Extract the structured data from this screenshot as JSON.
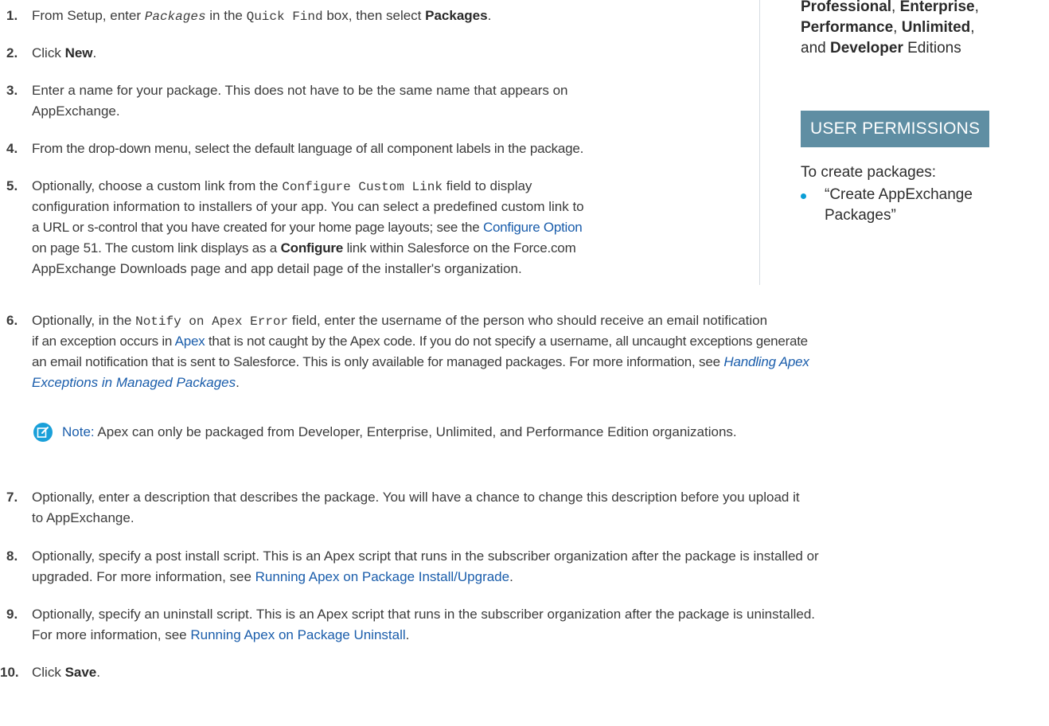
{
  "steps": {
    "s1": {
      "num": "1.",
      "pre": "From Setup, enter ",
      "code": "Packages",
      "mid": " in the ",
      "code2": "Quick Find",
      "post": " box, then select ",
      "bold": "Packages",
      "end": "."
    },
    "s2": {
      "num": "2.",
      "pre": "Click ",
      "bold": "New",
      "end": "."
    },
    "s3": {
      "num": "3.",
      "line1": "Enter a name for your package. This does not have to be the same name that appears on",
      "line2": "AppExchange."
    },
    "s4": {
      "num": "4.",
      "text": "From the drop-down menu, select the default language of all component labels in the package."
    },
    "s5": {
      "num": "5.",
      "l1_pre": "Optionally, choose a custom link from the ",
      "l1_code": "Configure Custom Link",
      "l1_post": " field to display",
      "l2": "configuration information to installers of your app. You can select a predefined custom link to",
      "l3_pre": "a URL or s-control that you have created for your home page layouts; see the ",
      "l3_link": "Configure Option",
      "l4_pre": "on page 51. The custom link displays as a ",
      "l4_bold": "Configure",
      "l4_post": " link within Salesforce on the Force.com",
      "l5": "AppExchange Downloads page and app detail page of the installer's organization."
    },
    "s6": {
      "num": "6.",
      "l1_pre": "Optionally, in the ",
      "l1_code": "Notify on Apex Error",
      "l1_post": " field, enter the username of the person who should receive an email notification",
      "l2_pre": "if an exception occurs in ",
      "l2_link": "Apex",
      "l2_post": " that is not caught by the Apex code. If you do not specify a username, all uncaught exceptions generate",
      "l3_pre": "an email notification that is sent to Salesforce. This is only available for managed packages. For more information, see ",
      "l3_link": "Handling Apex",
      "l4_link": "Exceptions in Managed Packages",
      "l4_end": "."
    },
    "note": {
      "label": "Note:",
      "text": " Apex can only be packaged from Developer, Enterprise, Unlimited, and Performance Edition organizations."
    },
    "s7": {
      "num": "7.",
      "line1": "Optionally, enter a description that describes the package. You will have a chance to change this description before you upload it",
      "line2": "to AppExchange."
    },
    "s8": {
      "num": "8.",
      "line1": "Optionally, specify a post install script. This is an Apex script that runs in the subscriber organization after the package is installed or",
      "line2_pre": "upgraded. For more information, see ",
      "line2_link": "Running Apex on Package Install/Upgrade",
      "line2_end": "."
    },
    "s9": {
      "num": "9.",
      "line1": "Optionally, specify an uninstall script. This is an Apex script that runs in the subscriber organization after the package is uninstalled.",
      "line2_pre": "For more information, see ",
      "line2_link": "Running Apex on Package Uninstall",
      "line2_end": "."
    },
    "s10": {
      "num": "10.",
      "pre": "Click ",
      "bold": "Save",
      "end": "."
    }
  },
  "sidebar": {
    "ed1": "Professional",
    "sep1": ", ",
    "ed2": "Enterprise",
    "sep2": ",",
    "ed3": "Performance",
    "sep3": ", ",
    "ed4": "Unlimited",
    "sep4": ",",
    "and": "and ",
    "ed5": "Developer",
    "editions": " Editions",
    "perm_header": "USER PERMISSIONS",
    "perm_text": "To create packages:",
    "perm_item": "“Create AppExchange Packages”"
  },
  "colors": {
    "link": "#1a5dab",
    "accent_header": "#5f8ea3",
    "bullet": "#0a9ed6",
    "note_icon": "#1aa0d9"
  },
  "icons": {
    "note": "edit-note-icon",
    "bullet": "bullet-icon"
  }
}
